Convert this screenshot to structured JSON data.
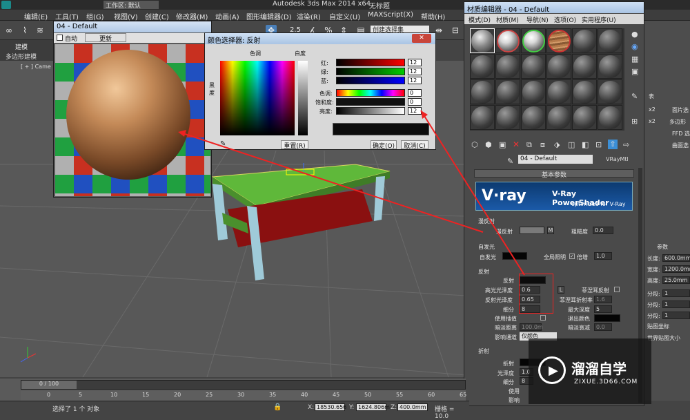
{
  "app": {
    "title": "Autodesk 3ds Max  2014 x64",
    "doc": "无标题",
    "workspace": "工作区: 默认",
    "menus": [
      "编辑(E)",
      "工具(T)",
      "组(G)",
      "视图(V)",
      "创建(C)",
      "修改器(M)",
      "动画(A)",
      "图形编辑器(D)",
      "渲染(R)",
      "自定义(U)",
      "MAXScript(X)",
      "帮助(H)"
    ],
    "toolbar_nums": "2.5",
    "selection_set": "创建选择集",
    "ribbon": [
      "建模",
      "多边形建模"
    ],
    "viewport_label": "[ + ] Came"
  },
  "small_dialog": {
    "title": "04 - Default",
    "auto": "自动",
    "update": "更新"
  },
  "color_picker": {
    "title": "颜色选择器: 反射",
    "hue_label": "色调",
    "whiteness_label": "白度",
    "blackness_label": "黑度",
    "rows": [
      {
        "label": "红:",
        "value": "12"
      },
      {
        "label": "绿:",
        "value": "12"
      },
      {
        "label": "蓝:",
        "value": "12"
      },
      {
        "label": "色调:",
        "value": "0"
      },
      {
        "label": "饱和度:",
        "value": "0"
      },
      {
        "label": "亮度:",
        "value": "12"
      }
    ],
    "reset": "重置(R)",
    "ok": "确定(O)",
    "cancel": "取消(C)"
  },
  "material_editor": {
    "title": "材质编辑器 - 04 - Default",
    "menus": [
      "模式(D)",
      "材质(M)",
      "导航(N)",
      "选项(O)",
      "实用程序(U)"
    ],
    "material_name": "04 - Default",
    "material_type": "VRayMtl",
    "basic_params": "基本参数",
    "vray_brand": "V·ray",
    "vray_title": "V-Ray PowerShader",
    "vray_sub": "optimized for V-Ray",
    "diffuse_section": "漫反射",
    "diffuse_label": "漫反射",
    "diffuse_m": "M",
    "roughness_label": "粗糙度",
    "roughness_value": "0.0",
    "self_illum_section": "自发光",
    "self_illum_label": "自发光",
    "gi_label": "全局照明",
    "multiplier_label": "倍增",
    "multiplier_value": "1.0",
    "reflection_section": "反射",
    "reflect_label": "反射",
    "hilight_gloss_label": "高光光泽度",
    "hilight_gloss_value": "0.6",
    "l_btn": "L",
    "fresnel_label": "菲涅耳反射",
    "refl_gloss_label": "反射光泽度",
    "refl_gloss_value": "0.65",
    "fresnel_ior_label": "菲涅耳折射率",
    "fresnel_ior_value": "1.6",
    "subdivs_label": "细分",
    "subdivs_value": "8",
    "max_depth_label": "最大深度",
    "max_depth_value": "5",
    "use_interp_label": "使用插值",
    "exit_color_label": "退出颜色",
    "dim_dist_label": "暗淡距离",
    "dim_dist_value": "100.0m",
    "dim_falloff_label": "暗淡衰减",
    "dim_falloff_value": "0.0",
    "affect_channels_label": "影响通道",
    "affect_channels_value": "仅颜色",
    "refraction_section": "折射",
    "refract_label": "折射",
    "gloss_label": "光泽度",
    "gloss_value": "1.0",
    "refr_subdivs_label": "细分",
    "refr_subdivs_value": "8",
    "use_label": "使用",
    "affect_label": "影响"
  },
  "right_panel": {
    "items": [
      "表",
      "x2",
      "面片选",
      "x2",
      "多边形",
      "FFD 选",
      "曲面选"
    ],
    "params_title": "参数",
    "length_label": "长度:",
    "length_value": "600.0mm",
    "width_label": "宽度:",
    "width_value": "1200.0mm",
    "height_label": "高度:",
    "height_value": "25.0mm",
    "segs": [
      {
        "label": "分段:",
        "value": "1"
      },
      {
        "label": "分段:",
        "value": "1"
      },
      {
        "label": "分段:",
        "value": "1"
      }
    ],
    "gen_map": "贴图坐标",
    "real_world": "世界贴图大小"
  },
  "timeline": {
    "frame": "0 / 100",
    "ticks": [
      "0",
      "5",
      "10",
      "15",
      "20",
      "25",
      "30",
      "35",
      "40",
      "45",
      "50",
      "55",
      "60",
      "65"
    ]
  },
  "status": {
    "message": "选择了 1 个 对象",
    "x_label": "X:",
    "x": "18530.656",
    "y_label": "Y:",
    "y": "1624.806m",
    "z_label": "Z:",
    "z": "400.0mm",
    "grid": "栅格 = 10.0"
  },
  "watermark": {
    "brand": "溜溜自学",
    "url": "ZIXUE.3D66.COM"
  },
  "colors": {
    "accent": "#3c8fd6",
    "annotation": "#e02020"
  }
}
